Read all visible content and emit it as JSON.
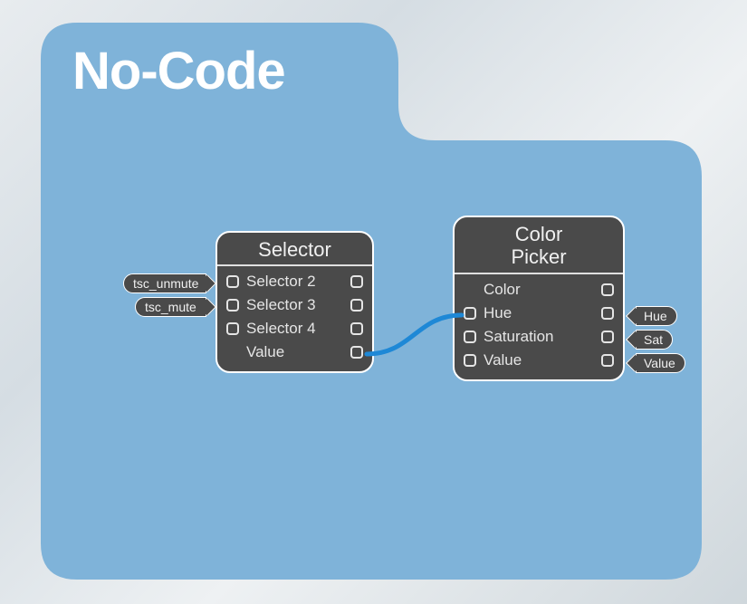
{
  "panel": {
    "title": "No-Code",
    "bg_color": "#7fb3d9"
  },
  "selector_node": {
    "title": "Selector",
    "rows": [
      {
        "label": "Selector 2",
        "has_in": true,
        "has_out": true
      },
      {
        "label": "Selector 3",
        "has_in": true,
        "has_out": true
      },
      {
        "label": "Selector 4",
        "has_in": true,
        "has_out": true
      },
      {
        "label": "Value",
        "has_in": false,
        "has_out": true
      }
    ],
    "in_tags": [
      "tsc_unmute",
      "tsc_mute"
    ]
  },
  "color_node": {
    "title": "Color\nPicker",
    "rows": [
      {
        "label": "Color",
        "has_in": false,
        "has_out": true
      },
      {
        "label": "Hue",
        "has_in": true,
        "has_out": true
      },
      {
        "label": "Saturation",
        "has_in": true,
        "has_out": true
      },
      {
        "label": "Value",
        "has_in": true,
        "has_out": true
      }
    ],
    "out_tags": [
      "Hue",
      "Sat",
      "Value"
    ]
  },
  "wire_color": "#1e88d6"
}
